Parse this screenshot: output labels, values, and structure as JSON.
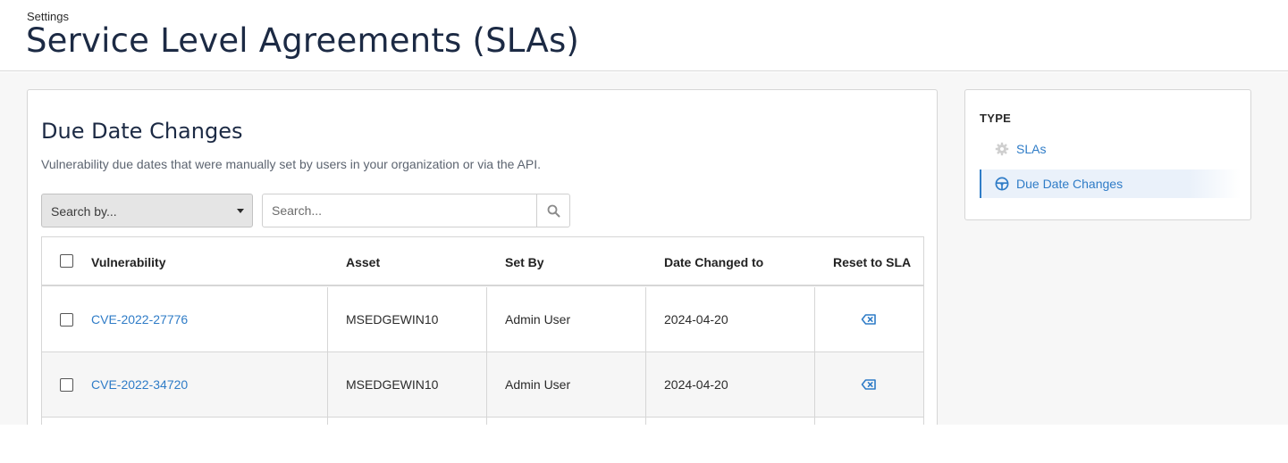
{
  "header": {
    "breadcrumb": "Settings",
    "title": "Service Level Agreements (SLAs)"
  },
  "main": {
    "section_title": "Due Date Changes",
    "description": "Vulnerability due dates that were manually set by users in your organization or via the API.",
    "search_by": {
      "selected": "Search by..."
    },
    "search": {
      "placeholder": "Search...",
      "value": ""
    },
    "table": {
      "columns": [
        "Vulnerability",
        "Asset",
        "Set By",
        "Date Changed to",
        "Reset to SLA"
      ],
      "rows": [
        {
          "vulnerability": "CVE-2022-27776",
          "asset": "MSEDGEWIN10",
          "set_by": "Admin User",
          "date_changed_to": "2024-04-20"
        },
        {
          "vulnerability": "CVE-2022-34720",
          "asset": "MSEDGEWIN10",
          "set_by": "Admin User",
          "date_changed_to": "2024-04-20"
        }
      ]
    }
  },
  "sidebar": {
    "type_label": "TYPE",
    "items": [
      {
        "label": "SLAs",
        "icon": "gear-icon",
        "active": false
      },
      {
        "label": "Due Date Changes",
        "icon": "steering-wheel-icon",
        "active": true
      }
    ]
  },
  "colors": {
    "link": "#2f7cc7",
    "title": "#1c2a44",
    "active_nav_bg": "#eaf1fa"
  }
}
